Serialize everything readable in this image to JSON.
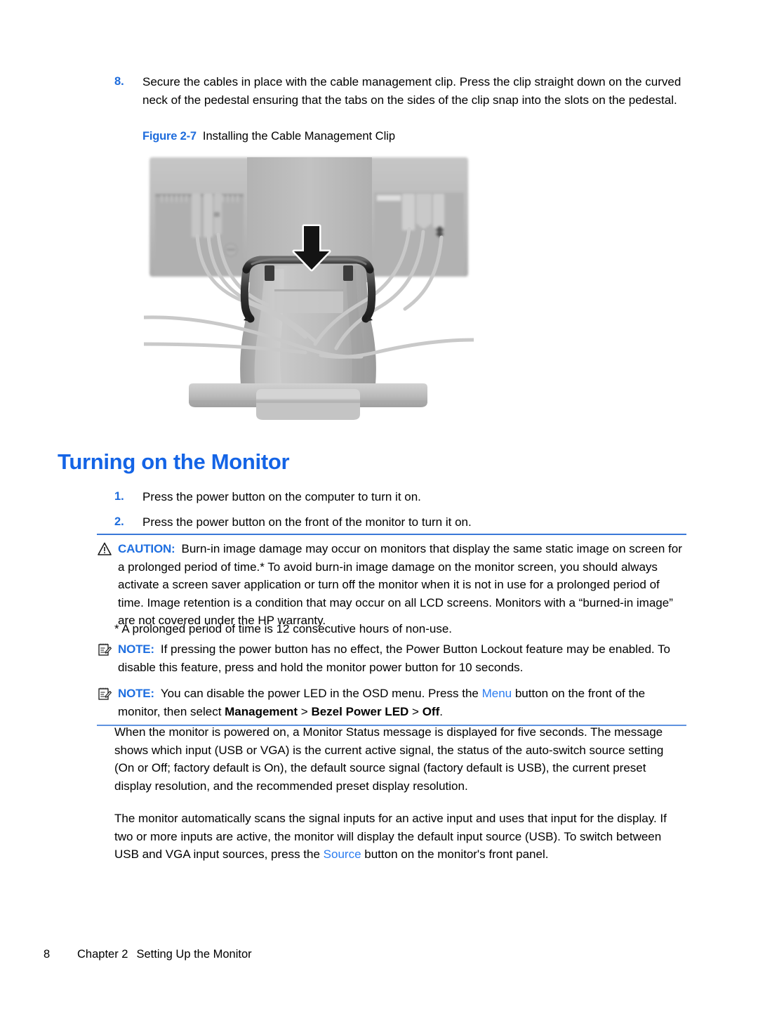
{
  "document": {
    "step": {
      "number": "8.",
      "text": "Secure the cables in place with the cable management clip. Press the clip straight down on the curved neck of the pedestal ensuring that the tabs on the sides of the clip snap into the slots on the pedestal."
    },
    "figure": {
      "label": "Figure 2-7",
      "title": "Installing the Cable Management Clip",
      "alt": "Illustration of a monitor rear with cables routed through a cable management clip being pressed down onto the pedestal neck",
      "arrow_icon": "down-arrow-icon"
    },
    "heading": "Turning on the Monitor",
    "steps": [
      {
        "number": "1.",
        "text": "Press the power button on the computer to turn it on."
      },
      {
        "number": "2.",
        "text": "Press the power button on the front of the monitor to turn it on."
      }
    ],
    "caution": {
      "icon": "warning-triangle-icon",
      "title": "CAUTION:",
      "text": "Burn-in image damage may occur on monitors that display the same static image on screen for a prolonged period of time.* To avoid burn-in image damage on the monitor screen, you should always activate a screen saver application or turn off the monitor when it is not in use for a prolonged period of time. Image retention is a condition that may occur on all LCD screens. Monitors with a “burned-in image” are not covered under the HP warranty."
    },
    "footnote": "* A prolonged period of time is 12 consecutive hours of non-use.",
    "notes": [
      {
        "icon": "note-pad-pencil-icon",
        "title": "NOTE:",
        "text": "If pressing the power button has no effect, the Power Button Lockout feature may be enabled. To disable this feature, press and hold the monitor power button for 10 seconds."
      },
      {
        "icon": "note-pad-pencil-icon",
        "title": "NOTE:",
        "text_part1": "You can disable the power LED in the OSD menu. Press the ",
        "link1": "Menu",
        "text_part2": " button on the front of the monitor, then select ",
        "bold1": "Management",
        "text_part3": " > ",
        "bold2": "Bezel Power LED",
        "text_part4": " > ",
        "bold3": "Off",
        "text_part5": "."
      }
    ],
    "paragraphs": [
      {
        "text": "When the monitor is powered on, a Monitor Status message is displayed for five seconds. The message shows which input (USB or VGA) is the current active signal, the status of the auto-switch source setting (On or Off; factory default is On), the default source signal (factory default is USB), the current preset display resolution, and the recommended preset display resolution."
      },
      {
        "text_part1": "The monitor automatically scans the signal inputs for an active input and uses that input for the display. If two or more inputs are active, the monitor will display the default input source (USB). To switch between USB and VGA input sources, press the ",
        "link1": "Source",
        "text_part2": " button on the monitor's front panel."
      }
    ],
    "footer": {
      "page_number": "8",
      "chapter": "Chapter 2",
      "chapter_title": "Setting Up the Monitor"
    },
    "colors": {
      "heading_blue": "#1464e6",
      "accent_blue": "#1e6cdc",
      "link_blue": "#2b7cf0",
      "rule_blue": "#3a78d8",
      "text_black": "#000000"
    }
  }
}
